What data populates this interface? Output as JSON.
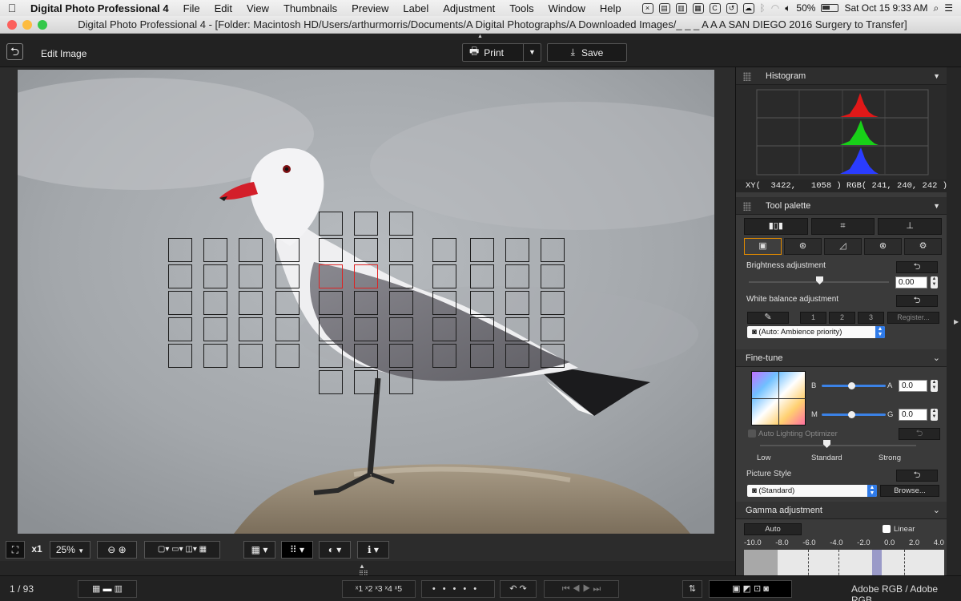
{
  "menubar": {
    "app_name": "Digital Photo Professional 4",
    "items": [
      "File",
      "Edit",
      "View",
      "Thumbnails",
      "Preview",
      "Label",
      "Adjustment",
      "Tools",
      "Window",
      "Help"
    ],
    "battery": "50%",
    "clock": "Sat Oct 15  9:33 AM"
  },
  "window": {
    "title": "Digital Photo Professional 4 - [Folder: Macintosh HD/Users/arthurmorris/Documents/A Digital Photographs/A Downloaded Images/_ _ _ A A A SAN DIEGO 2016 Surgery to Transfer]"
  },
  "toolbar": {
    "edit_label": "Edit Image",
    "print_label": "Print",
    "save_label": "Save"
  },
  "panel": {
    "histogram": {
      "title": "Histogram",
      "xy_readout": "XY(  3422,   1058 ) RGB( 241, 240, 242 )"
    },
    "tool_palette": {
      "title": "Tool palette",
      "brightness_label": "Brightness adjustment",
      "brightness_value": "0.00",
      "white_balance_label": "White balance adjustment",
      "wb_presets": [
        "1",
        "2",
        "3"
      ],
      "register_label": "Register...",
      "wb_select": "(Auto: Ambience priority)"
    },
    "fine_tune": {
      "title": "Fine-tune",
      "b_label": "B",
      "a_label": "A",
      "a_value": "0.0",
      "m_label": "M",
      "g_label": "G",
      "g_value": "0.0",
      "alo_label": "Auto Lighting Optimizer",
      "alo_levels": [
        "Low",
        "Standard",
        "Strong"
      ],
      "picture_style_label": "Picture Style",
      "picture_style_value": "(Standard)",
      "browse_label": "Browse..."
    },
    "gamma": {
      "title": "Gamma adjustment",
      "auto_label": "Auto",
      "linear_label": "Linear",
      "scale": [
        "-10.0",
        "-8.0",
        "-6.0",
        "-4.0",
        "-2.0",
        "0.0",
        "2.0",
        "4.0"
      ]
    }
  },
  "viewer": {
    "zoom_multiplier": "x1",
    "zoom_value": "25%"
  },
  "status": {
    "page_counter": "1 / 93",
    "ratings": [
      "1",
      "2",
      "3",
      "4",
      "5"
    ],
    "color_space": "Adobe RGB / Adobe RGB"
  }
}
